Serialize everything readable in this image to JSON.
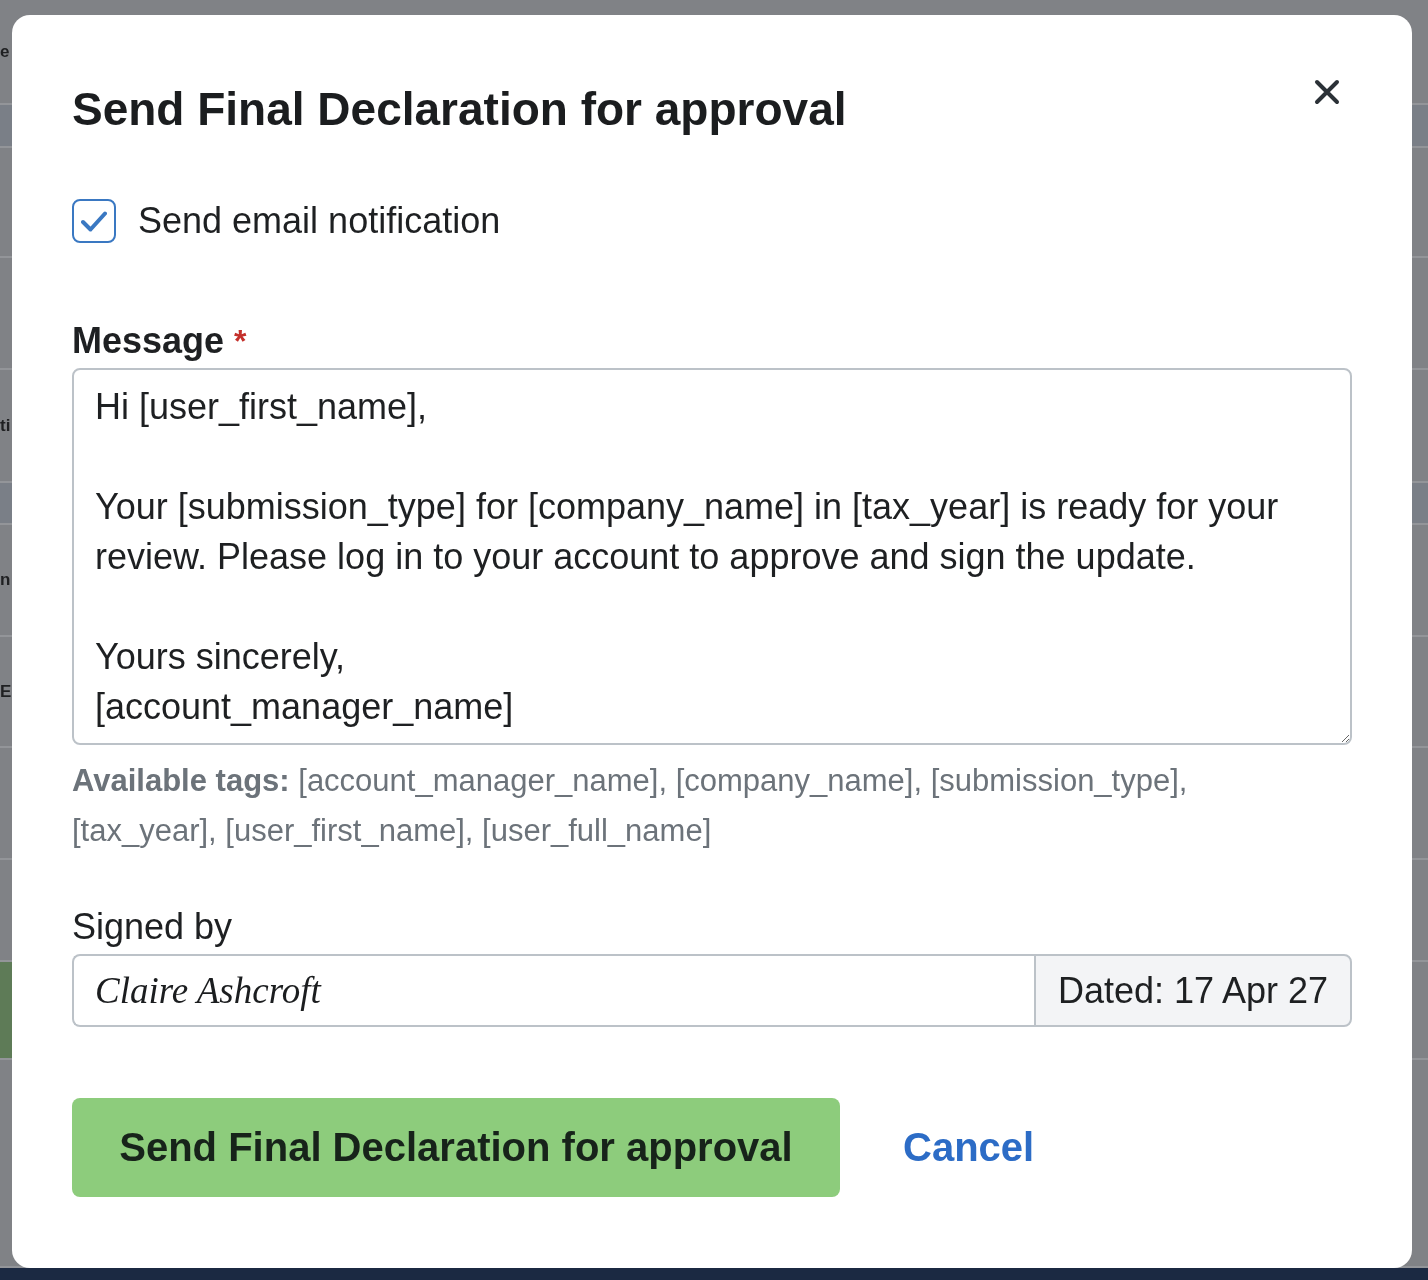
{
  "backdrop": {
    "fragments": [
      "e",
      "ti",
      "n",
      "E"
    ]
  },
  "dialog": {
    "title": "Send Final Declaration for approval",
    "email_notification": {
      "label": "Send email notification",
      "checked": true
    },
    "message": {
      "label": "Message",
      "required_mark": "*",
      "value": "Hi [user_first_name],\n\nYour [submission_type] for [company_name] in [tax_year] is ready for your review. Please log in to your account to approve and sign the update.\n\nYours sincerely,\n[account_manager_name]"
    },
    "tags_hint": "**Available tags:** [account_manager_name], [company_name], [submission_type], [tax_year], [user_first_name], [user_full_name]",
    "signature": {
      "label": "Signed by",
      "value": "Claire Ashcroft",
      "date": "Dated: 17 Apr 27"
    },
    "buttons": [
      {
        "label": "Send Final Declaration for approval",
        "kind": "primary"
      },
      {
        "label": "Cancel",
        "kind": "link"
      }
    ]
  }
}
